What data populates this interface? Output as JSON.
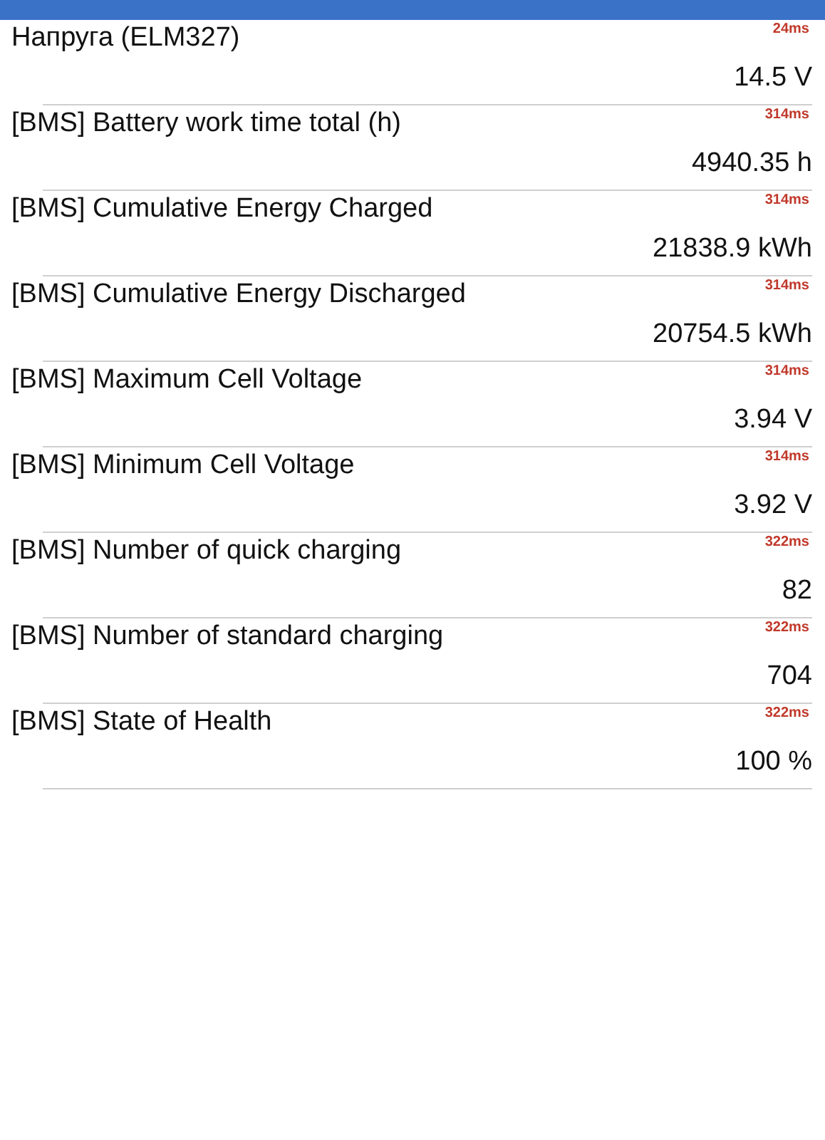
{
  "rows": [
    {
      "name": "Напруга (ELM327)",
      "timing": "24ms",
      "value": "14.5 V"
    },
    {
      "name": "[BMS] Battery work time total (h)",
      "timing": "314ms",
      "value": "4940.35 h"
    },
    {
      "name": "[BMS] Cumulative Energy Charged",
      "timing": "314ms",
      "value": "21838.9 kWh"
    },
    {
      "name": "[BMS] Cumulative Energy Discharged",
      "timing": "314ms",
      "value": "20754.5 kWh"
    },
    {
      "name": "[BMS] Maximum Cell Voltage",
      "timing": "314ms",
      "value": "3.94 V"
    },
    {
      "name": "[BMS] Minimum Cell Voltage",
      "timing": "314ms",
      "value": "3.92 V"
    },
    {
      "name": "[BMS] Number of quick charging",
      "timing": "322ms",
      "value": "82"
    },
    {
      "name": "[BMS] Number of standard charging",
      "timing": "322ms",
      "value": "704"
    },
    {
      "name": "[BMS] State of Health",
      "timing": "322ms",
      "value": "100 %"
    }
  ]
}
